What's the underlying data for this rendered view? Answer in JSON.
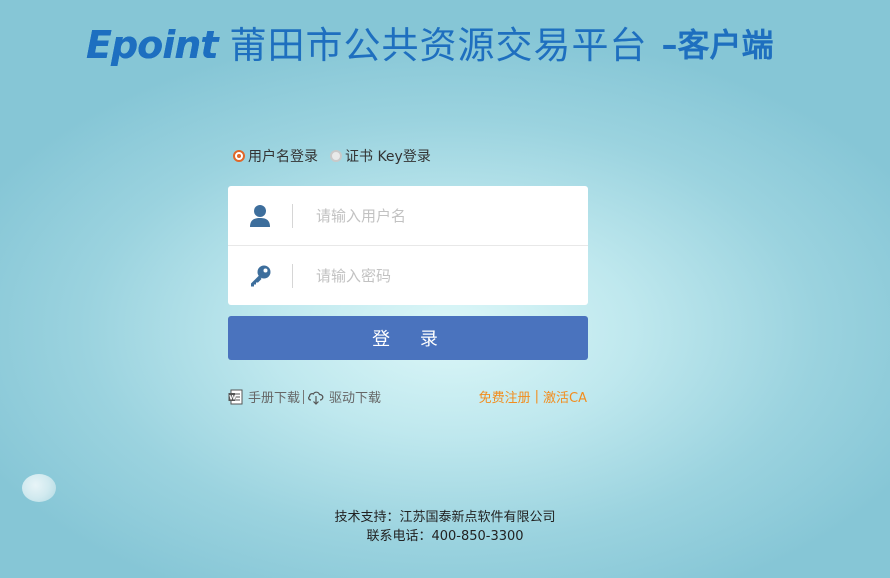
{
  "header": {
    "logo_text": "Epoint",
    "title": "莆田市公共资源交易平台",
    "suffix": "–客户端"
  },
  "login_type": {
    "options": [
      {
        "label": "用户名登录",
        "selected": true
      },
      {
        "label": "证书 Key登录",
        "selected": false
      }
    ]
  },
  "form": {
    "username_placeholder": "请输入用户名",
    "username_value": "",
    "password_placeholder": "请输入密码",
    "password_value": "",
    "username_icon": "user-icon",
    "password_icon": "key-icon"
  },
  "login_button": "登 录",
  "links": {
    "manual": "手册下载",
    "driver": "驱动下载",
    "register": "免费注册",
    "activate": "激活CA"
  },
  "footer": {
    "support": "技术支持：江苏国泰新点软件有限公司",
    "phone": "联系电话：400-850-3300"
  },
  "colors": {
    "accent": "#4a73be",
    "title": "#1e6fbf",
    "link_orange": "#f28d1e",
    "radio_active": "#e0682a"
  }
}
